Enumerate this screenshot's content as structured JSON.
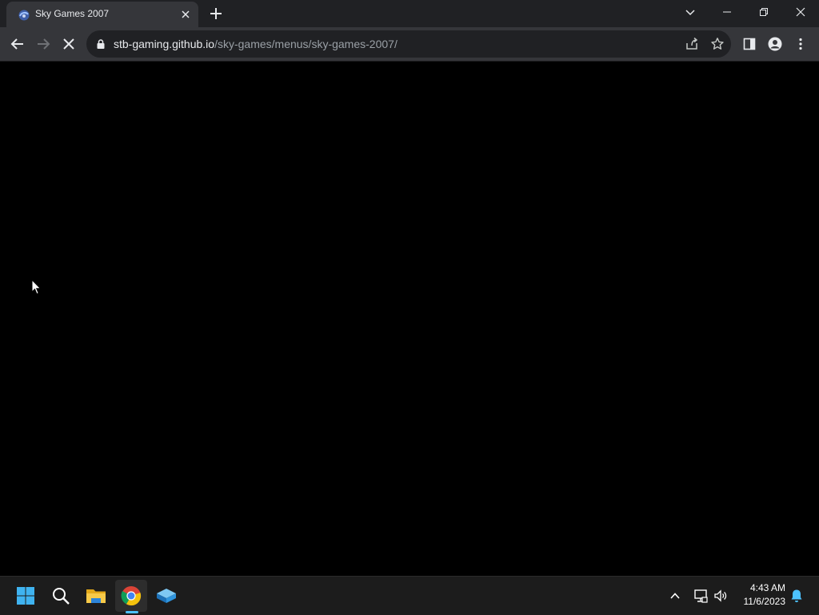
{
  "browser": {
    "tab": {
      "title": "Sky Games 2007"
    },
    "address": {
      "host": "stb-gaming.github.io",
      "path": "/sky-games/menus/sky-games-2007/"
    }
  },
  "taskbar": {
    "clock": {
      "time": "4:43 AM",
      "date": "11/6/2023"
    }
  },
  "colors": {
    "titlebar": "#202124",
    "toolbar": "#35363a",
    "content": "#000000",
    "taskbar": "#1c1c1c",
    "accent": "#4cc2ff"
  }
}
